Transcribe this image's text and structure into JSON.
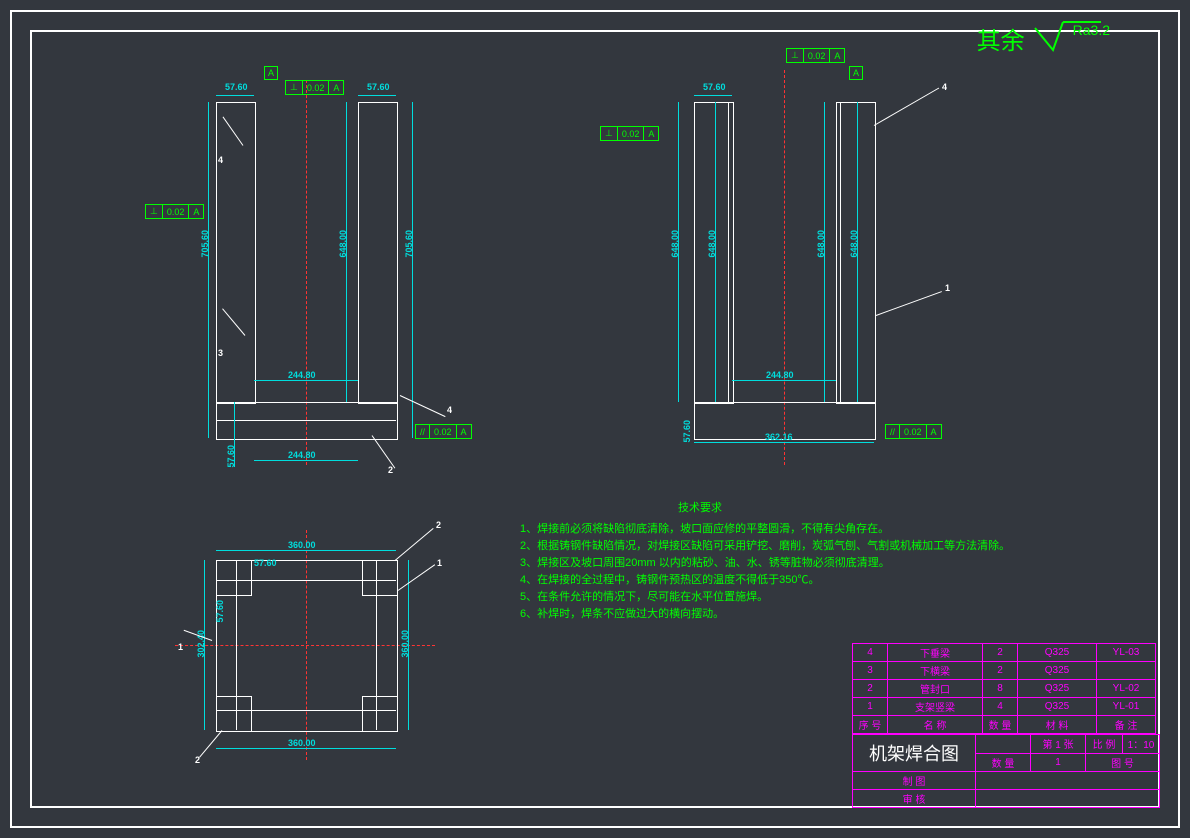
{
  "surface": {
    "label": "其余",
    "value": "Ra3.2"
  },
  "datum": "A",
  "gdt": {
    "tol": "0.02",
    "ref": "A",
    "perp": "⊥",
    "para": "//"
  },
  "dims": {
    "d5760": "57.60",
    "d24480": "244.80",
    "d70560": "705.60",
    "d64800": "648.00",
    "d36000": "360.00",
    "d36216": "362.16",
    "d30240": "302.40"
  },
  "leaders": {
    "n1": "1",
    "n2": "2",
    "n3": "3",
    "n4": "4"
  },
  "notes": {
    "title": "技术要求",
    "l1": "1、焊接前必须将缺陷彻底清除，坡口面应修的平整圆滑，不得有尖角存在。",
    "l2": "2、根据铸钢件缺陷情况，对焊接区缺陷可采用铲挖、磨削，炭弧气刨、气割或机械加工等方法清除。",
    "l3": "3、焊接区及坡口周围20mm 以内的粘砂、油、水、锈等脏物必须彻底清理。",
    "l4": "4、在焊接的全过程中，铸钢件预热区的温度不得低于350℃。",
    "l5": "5、在条件允许的情况下，尽可能在水平位置施焊。",
    "l6": "6、补焊时，焊条不应做过大的横向摆动。"
  },
  "bom": {
    "r4": {
      "no": "4",
      "name": "下垂梁",
      "qty": "2",
      "mat": "Q325",
      "rem": "YL-03"
    },
    "r3": {
      "no": "3",
      "name": "下横梁",
      "qty": "2",
      "mat": "Q325",
      "rem": ""
    },
    "r2": {
      "no": "2",
      "name": "管封口",
      "qty": "8",
      "mat": "Q325",
      "rem": "YL-02"
    },
    "r1": {
      "no": "1",
      "name": "支架竖梁",
      "qty": "4",
      "mat": "Q325",
      "rem": "YL-01"
    },
    "h": {
      "no": "序 号",
      "name": "名  称",
      "qty": "数 量",
      "mat": "材    料",
      "rem": "备  注"
    }
  },
  "tb": {
    "title": "机架焊合图",
    "qty_h": "数  量",
    "qty": "1",
    "sheet_h": "第 1 张",
    "scale_h": "比 例",
    "scale": "1：10",
    "drawno_h": "图 号",
    "drawn": "制 图",
    "check": "审 核"
  }
}
